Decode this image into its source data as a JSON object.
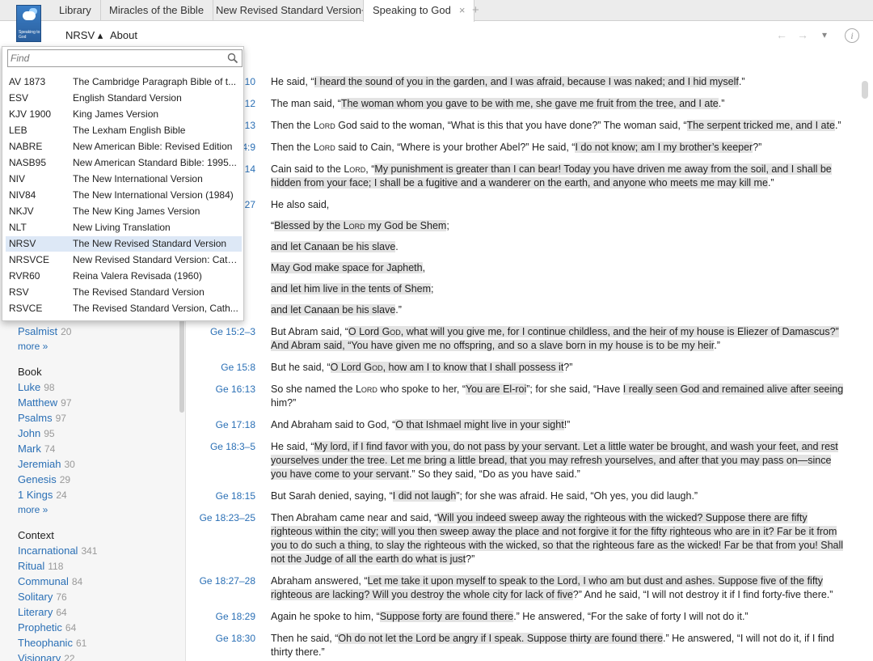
{
  "tabs": [
    {
      "label": "Library"
    },
    {
      "label": "Miracles of the Bible"
    },
    {
      "label": "New Revised Standard Version+"
    },
    {
      "label": "Speaking to God",
      "close": "×"
    }
  ],
  "tab_add": "+",
  "logo_text": "Speaking to God",
  "toolbar": {
    "version": "NRSV ▴",
    "about": "About",
    "back": "←",
    "forward": "→",
    "menu": "▾",
    "info": "i"
  },
  "dropdown": {
    "find_placeholder": "Find",
    "versions": [
      {
        "abbr": "AV 1873",
        "name": "The Cambridge Paragraph Bible of t..."
      },
      {
        "abbr": "ESV",
        "name": "English Standard Version"
      },
      {
        "abbr": "KJV 1900",
        "name": "King James Version"
      },
      {
        "abbr": "LEB",
        "name": "The Lexham English Bible"
      },
      {
        "abbr": "NABRE",
        "name": "New American Bible: Revised Edition"
      },
      {
        "abbr": "NASB95",
        "name": "New American Standard Bible: 1995..."
      },
      {
        "abbr": "NIV",
        "name": "The New International Version"
      },
      {
        "abbr": "NIV84",
        "name": "The New International Version (1984)"
      },
      {
        "abbr": "NKJV",
        "name": "The New King James Version"
      },
      {
        "abbr": "NLT",
        "name": "New Living Translation"
      },
      {
        "abbr": "NRSV",
        "name": "The New Revised Standard Version",
        "selected": true
      },
      {
        "abbr": "NRSVCE",
        "name": "New Revised Standard Version: Cath..."
      },
      {
        "abbr": "RVR60",
        "name": "Reina Valera Revisada (1960)"
      },
      {
        "abbr": "RSV",
        "name": "The Revised Standard Version"
      },
      {
        "abbr": "RSVCE",
        "name": "The Revised Standard Version, Cath..."
      }
    ]
  },
  "sidebar": {
    "psalmist": {
      "label": "Psalmist",
      "count": "20"
    },
    "more1": "more »",
    "book_heading": "Book",
    "books": [
      {
        "label": "Luke",
        "count": "98"
      },
      {
        "label": "Matthew",
        "count": "97"
      },
      {
        "label": "Psalms",
        "count": "97"
      },
      {
        "label": "John",
        "count": "95"
      },
      {
        "label": "Mark",
        "count": "74"
      },
      {
        "label": "Jeremiah",
        "count": "30"
      },
      {
        "label": "Genesis",
        "count": "29"
      },
      {
        "label": "1 Kings",
        "count": "24"
      }
    ],
    "more2": "more »",
    "context_heading": "Context",
    "contexts": [
      {
        "label": "Incarnational",
        "count": "341"
      },
      {
        "label": "Ritual",
        "count": "118"
      },
      {
        "label": "Communal",
        "count": "84"
      },
      {
        "label": "Solitary",
        "count": "76"
      },
      {
        "label": "Literary",
        "count": "64"
      },
      {
        "label": "Prophetic",
        "count": "64"
      },
      {
        "label": "Theophanic",
        "count": "61"
      },
      {
        "label": "Visionary",
        "count": "22"
      }
    ]
  },
  "verses": [
    {
      "ref": "10",
      "parts": [
        [
          "He said, “",
          0
        ],
        [
          "I heard the sound of you in the garden, and I was afraid, because I was naked; and I hid myself",
          1
        ],
        [
          ".”",
          0
        ]
      ]
    },
    {
      "ref": "12",
      "parts": [
        [
          "The man said, “",
          0
        ],
        [
          "The woman whom you gave to be with me, she gave me fruit from the tree, and I ate",
          1
        ],
        [
          ".”",
          0
        ]
      ]
    },
    {
      "ref": "13",
      "parts": [
        [
          "Then the ",
          0
        ],
        [
          "Lord",
          2
        ],
        [
          " God said to the woman, “What is this that you have done?” The woman said, “",
          0
        ],
        [
          "The serpent tricked me, and I ate",
          1
        ],
        [
          ".”",
          0
        ]
      ]
    },
    {
      "ref": "4:9",
      "parts": [
        [
          "Then the ",
          0
        ],
        [
          "Lord",
          2
        ],
        [
          " said to Cain, “Where is your brother Abel?” He said, “",
          0
        ],
        [
          "I do not know; am I my brother’s keeper",
          1
        ],
        [
          "?”",
          0
        ]
      ]
    },
    {
      "ref": "14",
      "parts": [
        [
          "Cain said to the ",
          0
        ],
        [
          "Lord",
          2
        ],
        [
          ", “",
          0
        ],
        [
          "My punishment is greater than I can bear! Today you have driven me away from the soil, and I shall be hidden from your face; I shall be a fugitive and a wanderer on the earth, and anyone who meets me may kill me",
          1
        ],
        [
          ".”",
          0
        ]
      ]
    },
    {
      "ref": "27",
      "parts": [
        [
          "He also said,",
          0
        ]
      ]
    },
    {
      "ref": "",
      "parts": [
        [
          "“",
          0
        ],
        [
          "Blessed by the ",
          1
        ],
        [
          "Lord",
          3
        ],
        [
          " my God be Shem",
          1
        ],
        [
          ";",
          0
        ]
      ]
    },
    {
      "ref": "",
      "parts": [
        [
          "and let Canaan be his slave",
          1
        ],
        [
          ".",
          0
        ]
      ]
    },
    {
      "ref": "",
      "parts": [
        [
          "May God make space for Japheth",
          1
        ],
        [
          ",",
          0
        ]
      ]
    },
    {
      "ref": "",
      "parts": [
        [
          "and let him live in the tents of Shem",
          1
        ],
        [
          ";",
          0
        ]
      ]
    },
    {
      "ref": "",
      "parts": [
        [
          "and let Canaan be his slave",
          1
        ],
        [
          ".”",
          0
        ]
      ]
    },
    {
      "ref": "Ge 15:2–3",
      "parts": [
        [
          "But Abram said, “",
          0
        ],
        [
          "O Lord ",
          1
        ],
        [
          "God",
          3
        ],
        [
          ", what will you give me, for I continue childless, and the heir of my house is Eliezer of Damascus?” And Abram said, “You have given me no offspring, and so a slave born in my house is to be my heir",
          1
        ],
        [
          ".”",
          0
        ]
      ]
    },
    {
      "ref": "Ge 15:8",
      "parts": [
        [
          "But he said, “",
          0
        ],
        [
          "O Lord ",
          1
        ],
        [
          "God",
          3
        ],
        [
          ", how am I to know that I shall possess it",
          1
        ],
        [
          "?”",
          0
        ]
      ]
    },
    {
      "ref": "Ge 16:13",
      "parts": [
        [
          "So she named the ",
          0
        ],
        [
          "Lord",
          2
        ],
        [
          " who spoke to her, “",
          0
        ],
        [
          "You are El-roi",
          1
        ],
        [
          "”; for she said, “Have ",
          0
        ],
        [
          "I really seen God and remained alive after seeing",
          1
        ],
        [
          " him?”",
          0
        ]
      ]
    },
    {
      "ref": "Ge 17:18",
      "parts": [
        [
          "And Abraham said to God, “",
          0
        ],
        [
          "O that Ishmael might live in your sight",
          1
        ],
        [
          "!”",
          0
        ]
      ]
    },
    {
      "ref": "Ge 18:3–5",
      "parts": [
        [
          "He said, “",
          0
        ],
        [
          "My lord, if I find favor with you, do not pass by your servant. Let a little water be brought, and wash your feet, and rest yourselves under the tree. Let me bring a little bread, that you may refresh yourselves, and after that you may pass on—since you have come to your servant",
          1
        ],
        [
          ".” So they said, “Do as you have said.”",
          0
        ]
      ]
    },
    {
      "ref": "Ge 18:15",
      "parts": [
        [
          "But Sarah denied, saying, “",
          0
        ],
        [
          "I did not laugh",
          1
        ],
        [
          "”; for she was afraid. He said, “Oh yes, you did laugh.”",
          0
        ]
      ]
    },
    {
      "ref": "Ge 18:23–25",
      "parts": [
        [
          "Then Abraham came near and said, “",
          0
        ],
        [
          "Will you indeed sweep away the righteous with the wicked? Suppose there are fifty righteous within the city; will you then sweep away the place and not forgive it for the fifty righteous who are in it? Far be it from you to do such a thing, to slay the righteous with the wicked, so that the righteous fare as the wicked! Far be that from you! Shall not the Judge of all the earth do what is just",
          1
        ],
        [
          "?”",
          0
        ]
      ]
    },
    {
      "ref": "Ge 18:27–28",
      "parts": [
        [
          "Abraham answered, “",
          0
        ],
        [
          "Let me take it upon myself to speak to the Lord, I who am but dust and ashes. Suppose five of the fifty righteous are lacking? Will you destroy the whole city for lack of five",
          1
        ],
        [
          "?” And he said, “I will not destroy it if I find forty-five there.”",
          0
        ]
      ]
    },
    {
      "ref": "Ge 18:29",
      "parts": [
        [
          "Again he spoke to him, “",
          0
        ],
        [
          "Suppose forty are found there",
          1
        ],
        [
          ".” He answered, “For the sake of forty I will not do it.”",
          0
        ]
      ]
    },
    {
      "ref": "Ge 18:30",
      "parts": [
        [
          "Then he said, “",
          0
        ],
        [
          "Oh do not let the Lord be angry if I speak. Suppose thirty are found there",
          1
        ],
        [
          ".” He answered, “I will not do it, if I find thirty there.”",
          0
        ]
      ]
    }
  ]
}
